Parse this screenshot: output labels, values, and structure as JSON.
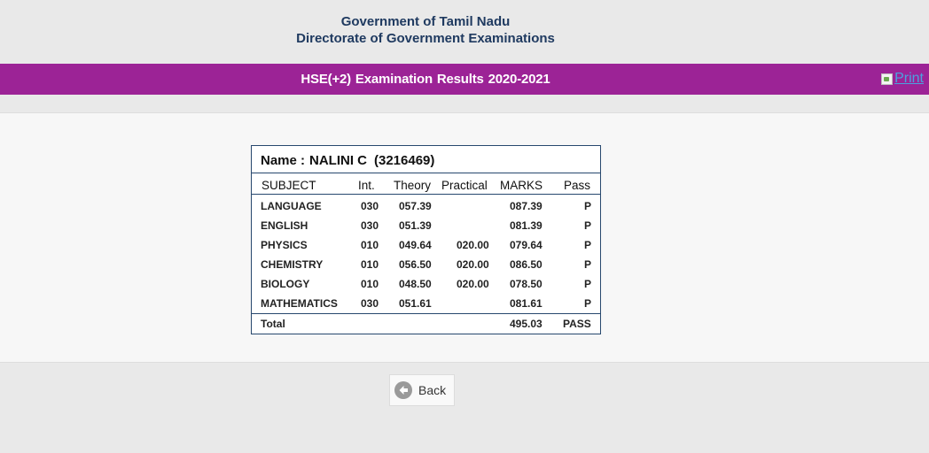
{
  "header": {
    "line1": "Government of Tamil Nadu",
    "line2": "Directorate of Government Examinations"
  },
  "banner": {
    "title": "HSE(+2)  Examination Results  2020-2021",
    "print_label": "Print",
    "color": "#9c2396"
  },
  "student": {
    "name_label": "Name :",
    "name": "NALINI C",
    "roll": "(3216469)"
  },
  "table": {
    "columns": [
      "SUBJECT",
      "Int.",
      "Theory",
      "Practical",
      "MARKS",
      "Pass"
    ],
    "rows": [
      {
        "subject": "LANGUAGE",
        "int": "030",
        "theory": "057.39",
        "practical": "",
        "marks": "087.39",
        "pass": "P"
      },
      {
        "subject": "ENGLISH",
        "int": "030",
        "theory": "051.39",
        "practical": "",
        "marks": "081.39",
        "pass": "P"
      },
      {
        "subject": "PHYSICS",
        "int": "010",
        "theory": "049.64",
        "practical": "020.00",
        "marks": "079.64",
        "pass": "P"
      },
      {
        "subject": "CHEMISTRY",
        "int": "010",
        "theory": "056.50",
        "practical": "020.00",
        "marks": "086.50",
        "pass": "P"
      },
      {
        "subject": "BIOLOGY",
        "int": "010",
        "theory": "048.50",
        "practical": "020.00",
        "marks": "078.50",
        "pass": "P"
      },
      {
        "subject": "MATHEMATICS",
        "int": "030",
        "theory": "051.61",
        "practical": "",
        "marks": "081.61",
        "pass": "P"
      }
    ],
    "total": {
      "label": "Total",
      "marks": "495.03",
      "result": "PASS"
    }
  },
  "back_button": {
    "label": "Back",
    "icon": "back-arrow-icon"
  }
}
